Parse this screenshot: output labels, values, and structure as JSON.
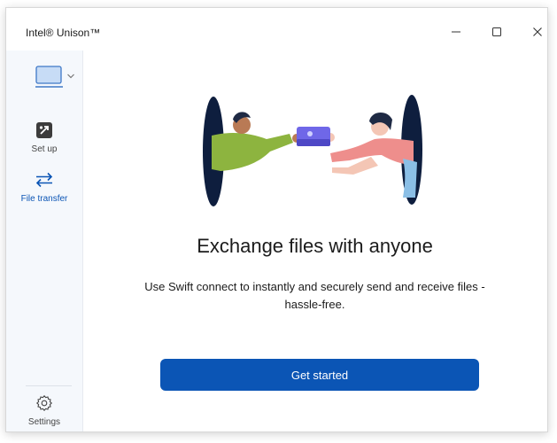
{
  "window": {
    "title": "Intel® Unison™",
    "controls": {
      "minimize": "minimize",
      "maximize": "maximize",
      "close": "close"
    }
  },
  "sidebar": {
    "device_icon": "laptop-icon",
    "items": [
      {
        "label": "Set up",
        "icon": "setup-icon",
        "active": false
      },
      {
        "label": "File transfer",
        "icon": "transfer-arrows-icon",
        "active": true
      }
    ],
    "settings": {
      "label": "Settings",
      "icon": "gear-icon"
    }
  },
  "main": {
    "heading": "Exchange files with anyone",
    "description": "Use Swift connect to instantly and securely send and receive files - hassle-free.",
    "cta_label": "Get started"
  },
  "colors": {
    "accent": "#0b55b5",
    "sidebar_bg": "#f5f8fc",
    "portal": "#0e1e3e",
    "green_shirt": "#8db43f",
    "pink_shirt": "#ee8e8c"
  }
}
